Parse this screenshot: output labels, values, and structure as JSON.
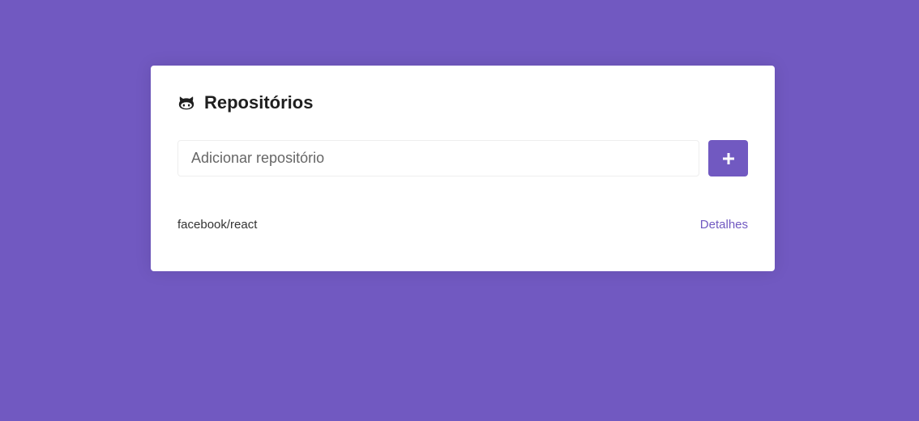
{
  "colors": {
    "background": "#7159c1",
    "card": "#ffffff",
    "accent": "#7159c1"
  },
  "header": {
    "icon": "github-icon",
    "title": "Repositórios"
  },
  "form": {
    "input_placeholder": "Adicionar repositório",
    "input_value": "",
    "submit_icon": "plus-icon"
  },
  "repositories": [
    {
      "name": "facebook/react",
      "link_label": "Detalhes"
    }
  ]
}
